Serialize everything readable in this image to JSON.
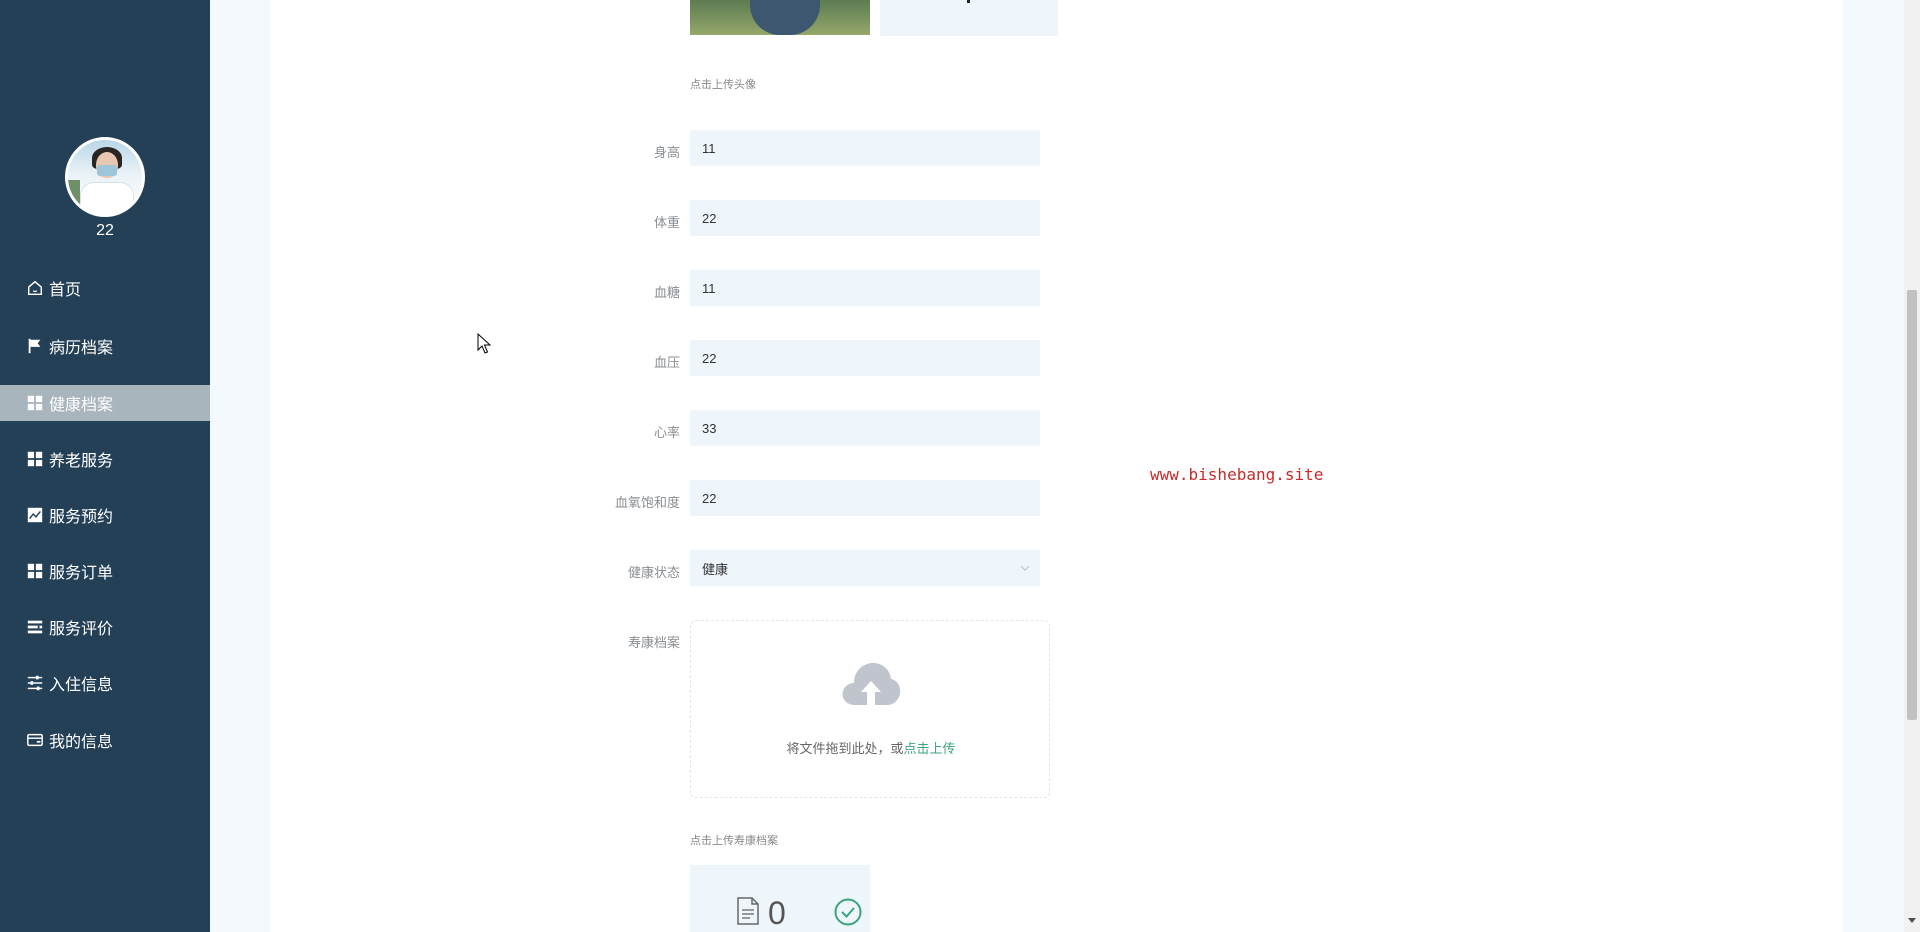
{
  "user": {
    "name": "22"
  },
  "nav": {
    "items": [
      {
        "label": "首页",
        "icon": "home-icon"
      },
      {
        "label": "病历档案",
        "icon": "flag-icon"
      },
      {
        "label": "健康档案",
        "icon": "grid-icon",
        "active": true
      },
      {
        "label": "养老服务",
        "icon": "grid-icon"
      },
      {
        "label": "服务预约",
        "icon": "chart-icon"
      },
      {
        "label": "服务订单",
        "icon": "grid-icon"
      },
      {
        "label": "服务评价",
        "icon": "list-icon"
      },
      {
        "label": "入住信息",
        "icon": "sliders-icon"
      },
      {
        "label": "我的信息",
        "icon": "card-icon"
      }
    ]
  },
  "form": {
    "avatar_hint": "点击上传头像",
    "fields": {
      "height": {
        "label": "身高",
        "value": "11"
      },
      "weight": {
        "label": "体重",
        "value": "22"
      },
      "blood_sugar": {
        "label": "血糖",
        "value": "11"
      },
      "blood_pressure": {
        "label": "血压",
        "value": "22"
      },
      "heart_rate": {
        "label": "心率",
        "value": "33"
      },
      "blood_oxygen": {
        "label": "血氧饱和度",
        "value": "22"
      },
      "health_status": {
        "label": "健康状态",
        "value": "健康"
      }
    },
    "archive": {
      "label": "寿康档案",
      "dropzone_text": "将文件拖到此处，或",
      "dropzone_link": "点击上传",
      "hint": "点击上传寿康档案",
      "file_count": "0"
    }
  },
  "watermark": "www.bishebang.site",
  "colors": {
    "sidebar_bg": "#234057",
    "active_item_bg": "#a8b5bd",
    "input_bg": "#eef6fc",
    "link_green": "#3aa57a",
    "watermark_red": "#c62b2b"
  }
}
